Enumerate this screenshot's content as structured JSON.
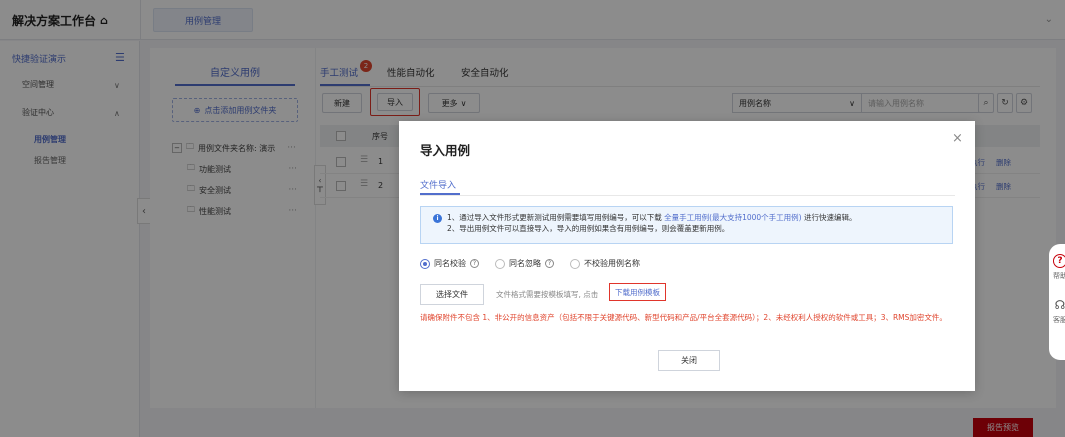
{
  "topbar": {
    "brand": "解决方案工作台",
    "crumb_tab": "用例管理"
  },
  "sidebar": {
    "header": "快捷验证演示",
    "items": [
      {
        "label": "空间管理"
      },
      {
        "label": "验证中心"
      }
    ],
    "subitems": [
      {
        "label": "用例管理"
      },
      {
        "label": "报告管理"
      }
    ]
  },
  "folder_panel": {
    "tab": "自定义用例",
    "add_button": "点击添加用例文件夹",
    "root": "用例文件夹名称: 演示",
    "children": [
      {
        "label": "功能测试"
      },
      {
        "label": "安全测试"
      },
      {
        "label": "性能测试"
      }
    ],
    "more_glyph": "···"
  },
  "main": {
    "tabs": [
      {
        "label": "手工测试"
      },
      {
        "label": "性能自动化"
      },
      {
        "label": "安全自动化"
      }
    ],
    "badge": "2",
    "toolbar": {
      "new": "新建",
      "import": "导入",
      "more": "更多"
    },
    "filter_select": "用例名称",
    "search_placeholder": "请输入用例名称",
    "table_header_seq": "序号",
    "rows": [
      {
        "seq": "1",
        "run": "执行",
        "del": "删除"
      },
      {
        "seq": "2",
        "run": "执行",
        "del": "删除"
      }
    ]
  },
  "floating": {
    "help": "帮助",
    "service": "客服"
  },
  "report_button": "报告预览",
  "modal": {
    "title": "导入用例",
    "tab": "文件导入",
    "info_line1_pre": "1、通过导入文件形式更新测试用例需要填写用例编号，可以下载",
    "info_line1_link": "全量手工用例(最大支持1000个手工用例)",
    "info_line1_post": "进行快速编辑。",
    "info_line2": "2、导出用例文件可以直接导入，导入的用例如果含有用例编号，则会覆盖更新用例。",
    "radios": [
      {
        "label": "同名校验",
        "checked": true,
        "help": true
      },
      {
        "label": "同名忽略",
        "checked": false,
        "help": true
      },
      {
        "label": "不校验用例名称",
        "checked": false,
        "help": false
      }
    ],
    "choose_file": "选择文件",
    "hint": "文件格式需要按模板填写, 点击",
    "template_link": "下载用例模板",
    "warning": "请确保附件不包含 1、非公开的信息资产（包括不限于关键源代码、新型代码和产品/平台全套源代码）；2、未经权利人授权的软件或工具；3、RMS加密文件。",
    "close_button": "关闭"
  },
  "colors": {
    "accent": "#526ecc",
    "danger": "#e0352b",
    "report": "#c7000b"
  }
}
